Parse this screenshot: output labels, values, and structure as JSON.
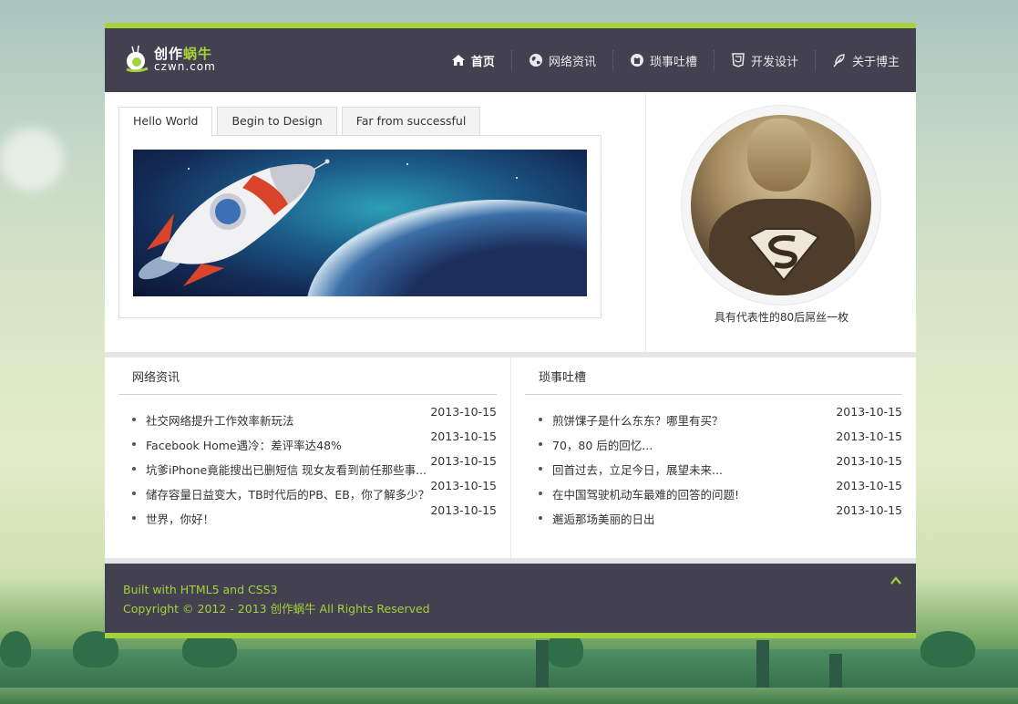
{
  "site": {
    "logo_cn_a": "创作",
    "logo_cn_b": "蜗牛",
    "logo_en": "czwn.com"
  },
  "nav": {
    "items": [
      {
        "label": "首页",
        "icon": "home-icon"
      },
      {
        "label": "网络资讯",
        "icon": "globe-icon"
      },
      {
        "label": "琐事吐槽",
        "icon": "github-icon"
      },
      {
        "label": "开发设计",
        "icon": "html5-icon"
      },
      {
        "label": "关于博主",
        "icon": "feather-icon"
      }
    ]
  },
  "tabs": [
    "Hello World",
    "Begin to Design",
    "Far from successful"
  ],
  "profile": {
    "caption": "具有代表性的80后屌丝一枚"
  },
  "news": {
    "title": "网络资讯",
    "items": [
      {
        "title": "社交网络提升工作效率新玩法",
        "date": "2013-10-15"
      },
      {
        "title": "Facebook Home遇冷：差评率达48%",
        "date": "2013-10-15"
      },
      {
        "title": "坑爹iPhone竟能搜出已删短信 现女友看到前任那些事...",
        "date": "2013-10-15"
      },
      {
        "title": "储存容量日益变大，TB时代后的PB、EB，你了解多少？",
        "date": "2013-10-15"
      },
      {
        "title": "世界，你好！",
        "date": "2013-10-15"
      }
    ]
  },
  "rants": {
    "title": "琐事吐槽",
    "items": [
      {
        "title": "煎饼馃子是什么东东？哪里有买？",
        "date": "2013-10-15"
      },
      {
        "title": "70，80 后的回忆...",
        "date": "2013-10-15"
      },
      {
        "title": "回首过去，立足今日，展望未来...",
        "date": "2013-10-15"
      },
      {
        "title": "在中国驾驶机动车最难的回答的问题!",
        "date": "2013-10-15"
      },
      {
        "title": "邂逅那场美丽的日出",
        "date": "2013-10-15"
      }
    ]
  },
  "footer": {
    "line1": "Built with HTML5 and CSS3",
    "line2": "Copyright © 2012 - 2013 创作蜗牛 All Rights Reserved"
  },
  "colors": {
    "accent": "#a4d23c",
    "header_bg": "#434150"
  }
}
